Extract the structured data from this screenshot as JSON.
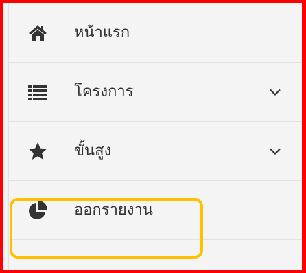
{
  "sidebar": {
    "items": [
      {
        "label": "หน้าแรก",
        "icon": "home-icon",
        "has_submenu": false
      },
      {
        "label": "โครงการ",
        "icon": "list-icon",
        "has_submenu": true
      },
      {
        "label": "ขั้นสูง",
        "icon": "star-icon",
        "has_submenu": true
      },
      {
        "label": "ออกรายงาน",
        "icon": "pie-chart-icon",
        "has_submenu": false
      }
    ]
  },
  "colors": {
    "frame_border": "#ff0000",
    "highlight_border": "#ffc000",
    "icon": "#333333",
    "text": "#333333",
    "background": "#f4f4f4"
  }
}
